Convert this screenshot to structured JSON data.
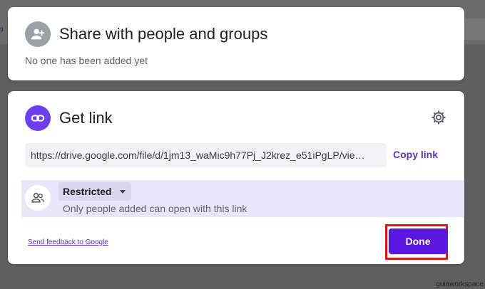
{
  "background": {
    "partial_text": "ți"
  },
  "share_section": {
    "title": "Share with people and groups",
    "empty_message": "No one has been added yet",
    "icon": "add-person-icon"
  },
  "link_section": {
    "title": "Get link",
    "icon": "link-icon",
    "settings_icon": "gear-icon",
    "url": "https://drive.google.com/file/d/1jm13_waMic9h77Pj_J2krez_e51iPgLP/vie…",
    "copy_label": "Copy link"
  },
  "access": {
    "icon": "people-icon",
    "selected": "Restricted",
    "description": "Only people added can open with this link"
  },
  "footer": {
    "feedback_label": "Send feedback to Google",
    "done_label": "Done"
  },
  "watermark": "guiaworkspace",
  "colors": {
    "accent": "#5b17e0",
    "link": "#5a34c9",
    "highlight_row": "#e8e6fb",
    "annotation_box": "#e01414"
  }
}
